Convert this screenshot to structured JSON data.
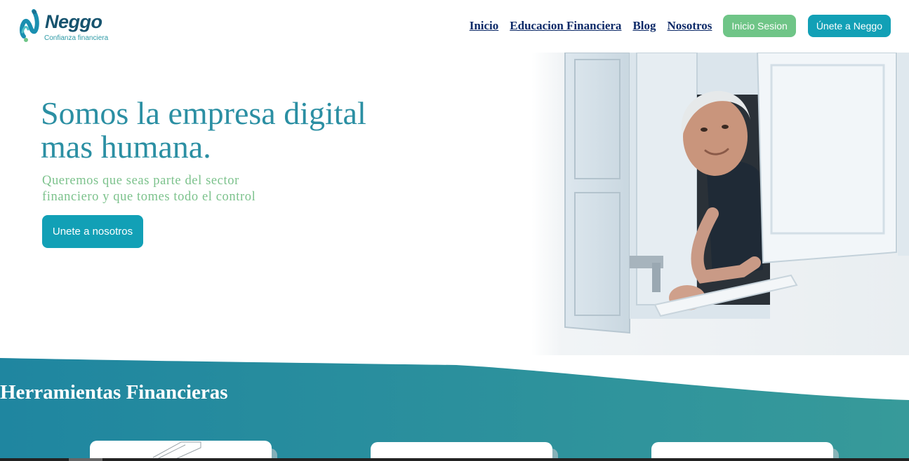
{
  "header": {
    "logo_name": "Neggo",
    "logo_tagline": "Confianza financiera",
    "nav": [
      {
        "label": "Inicio"
      },
      {
        "label": "Educacion Financiera"
      },
      {
        "label": "Blog"
      },
      {
        "label": "Nosotros"
      }
    ],
    "login_label": "Inicio Sesion",
    "join_label": "Únete a Neggo"
  },
  "hero": {
    "title_line1": "Somos la empresa digital",
    "title_line2": "mas humana.",
    "subtitle_line1": "Queremos que seas parte del sector",
    "subtitle_line2": "financiero y que tomes todo el control",
    "cta_label": "Unete a nosotros"
  },
  "tools": {
    "title": "Herramientas Financieras"
  },
  "colors": {
    "brand_dark": "#16536e",
    "brand_teal": "#12a0b6",
    "brand_green": "#6fc587",
    "nav_text": "#0d2a68",
    "section_teal_start": "#1f86a0",
    "section_teal_end": "#379a9a"
  }
}
